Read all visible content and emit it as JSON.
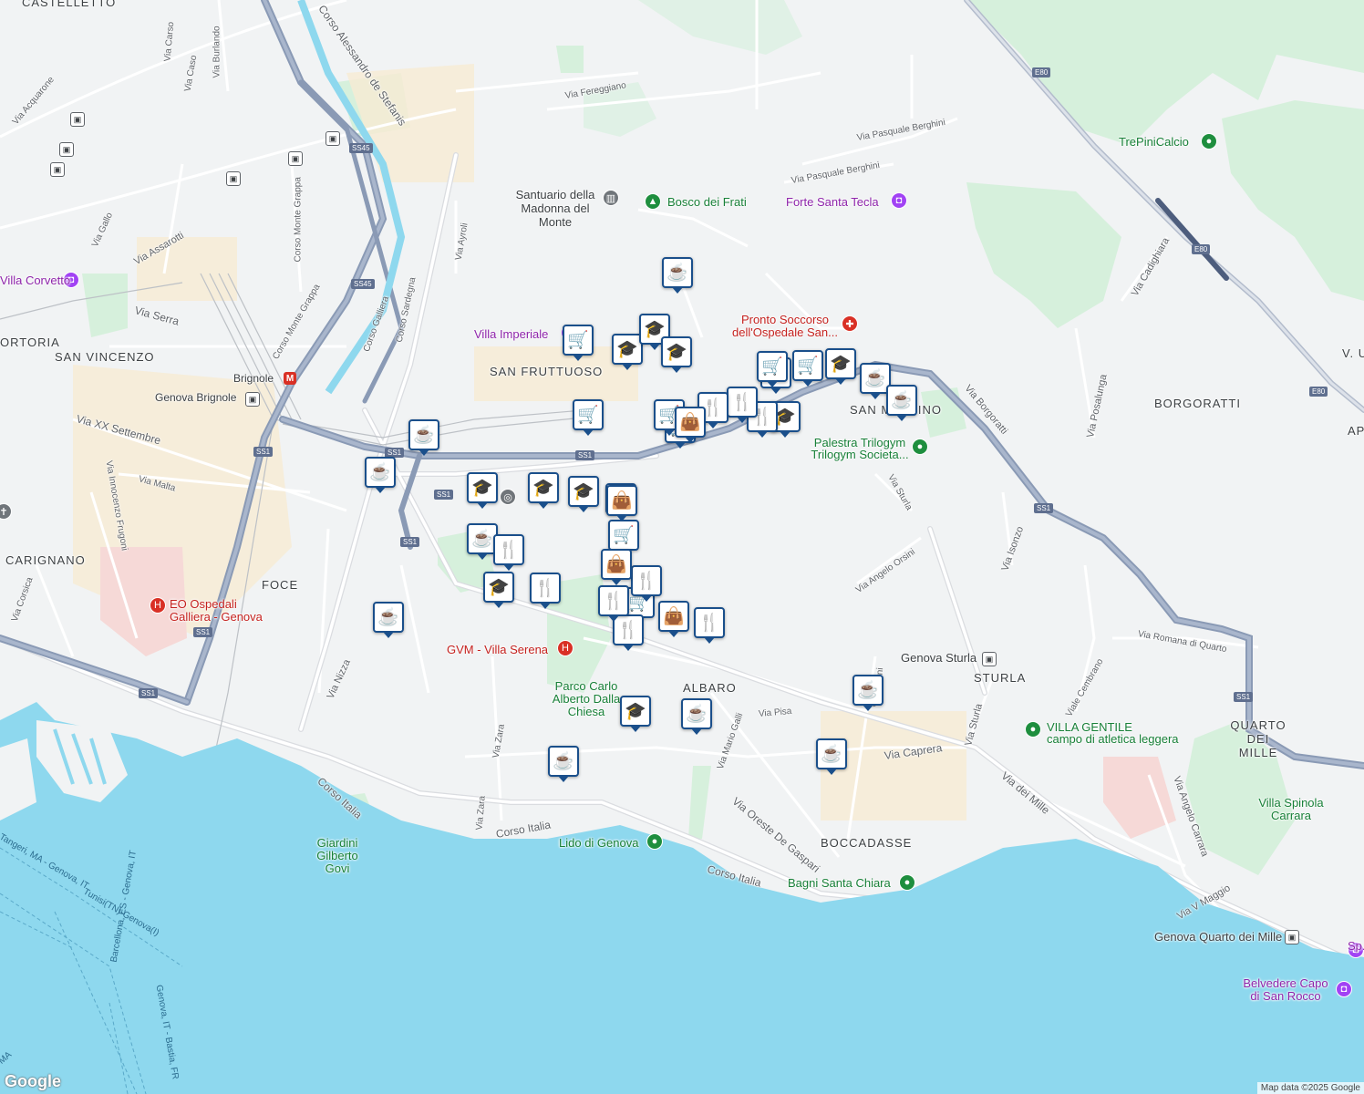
{
  "attribution": "Map data ©2025 Google",
  "logo": "Google",
  "colors": {
    "water": "#8ed8ee",
    "park": "#d6f0dc",
    "land": "#f1f3f4",
    "highway": "#8a9ab5",
    "marker_border": "#1a4f8b"
  },
  "districts": [
    "CASTELLETTO",
    "SAN VINCENZO",
    "ORTORIA",
    "SAN FRUTTUOSO",
    "CARIGNANO",
    "FOCE",
    "ALBARO",
    "SAN MARTINO",
    "BORGORATTI",
    "STURLA",
    "QUARTO DEI MILLE",
    "BOCCADASSE",
    "V. U",
    "AP"
  ],
  "streets": [
    "Via Pasquale Berghini",
    "Via Pasquale Berghini",
    "Via Fereggiano",
    "Via Acquarone",
    "Via Carso",
    "Via Caso",
    "Via Burlando",
    "Via Gallo",
    "Via Assarotti",
    "Corso Monte Grappa",
    "Corso Monte Grappa",
    "Via Serra",
    "Corso Galliera",
    "Corso Sardegna",
    "Via Ayroli",
    "Via XX Settembre",
    "Via Malta",
    "Via Innocenzo Frugoni",
    "Via Corsica",
    "Via Nizza",
    "Via Zara",
    "Via Zara",
    "Corso Italia",
    "Corso Italia",
    "Corso Italia",
    "Via Oreste De Gaspari",
    "Via Pisa",
    "Via Mario Galli",
    "Via Caprera",
    "Via dei Mille",
    "Via Sturla",
    "Via Sturla",
    "Via Angelo Orsini",
    "Via Isonzo",
    "Via Borgoratti",
    "Via Posalunga",
    "Via Cadighiara",
    "Viale Cembrano",
    "Via Romana di Quarto",
    "Via Angelo Carrara",
    "Via V Maggio",
    "Corso Alessandro de Stefanis",
    "Via Orsini",
    "Via Manuzio"
  ],
  "pois": [
    "Santuario della Madonna del Monte",
    "Bosco dei Frati",
    "Forte Santa Tecla",
    "Pronto Soccorso dell'Ospedale San...",
    "Villa Imperiale",
    "Palestra Trilogym Trilogym Societa...",
    "TrePiniCalcio",
    "Villa Corvetto",
    "Genova Brignole",
    "Brignole",
    "EO Ospedali Galliera - Genova",
    "GVM - Villa Serena",
    "Parco Carlo Alberto Dalla Chiesa",
    "Genova Sturla",
    "VILLA GENTILE",
    "campo di atletica leggera",
    "Lido di Genova",
    "Bagni Santa Chiara",
    "Giardini Gilberto Govi",
    "Villa Spinola Carrara",
    "Genova Quarto dei Mille",
    "Belvedere Capo di San Rocco",
    "Sp..."
  ],
  "road_shields": [
    "E80",
    "E80",
    "E80",
    "SS45",
    "SS45",
    "SS45",
    "SS1",
    "SS1",
    "SS1",
    "SS1",
    "SS1",
    "SS1",
    "SS1",
    "SS1"
  ],
  "sea_labels": [
    "Tunisi(TN)-Genova(I)",
    "Genova, IT - Bastia, FR",
    "Barcellona, ES - Genova, IT",
    "Tangeri, MA - Genova, IT",
    "Genova, IT",
    "MA"
  ],
  "markers": [
    {
      "type": "cafe",
      "icon": "coffee-cup"
    },
    {
      "type": "cafe",
      "icon": "coffee-cup"
    },
    {
      "type": "cafe",
      "icon": "coffee-cup"
    },
    {
      "type": "cafe",
      "icon": "coffee-cup"
    },
    {
      "type": "cafe",
      "icon": "coffee-cup"
    },
    {
      "type": "cafe",
      "icon": "coffee-cup"
    },
    {
      "type": "cafe",
      "icon": "coffee-cup"
    },
    {
      "type": "cafe",
      "icon": "coffee-cup"
    },
    {
      "type": "cafe",
      "icon": "coffee-cup"
    },
    {
      "type": "cafe",
      "icon": "coffee-cup"
    },
    {
      "type": "cafe",
      "icon": "coffee-cup"
    },
    {
      "type": "grocery",
      "icon": "shopping-cart"
    },
    {
      "type": "grocery",
      "icon": "shopping-cart"
    },
    {
      "type": "grocery",
      "icon": "shopping-cart"
    },
    {
      "type": "grocery",
      "icon": "shopping-cart"
    },
    {
      "type": "grocery",
      "icon": "shopping-cart"
    },
    {
      "type": "grocery",
      "icon": "shopping-cart"
    },
    {
      "type": "grocery",
      "icon": "shopping-cart"
    },
    {
      "type": "grocery",
      "icon": "shopping-cart"
    },
    {
      "type": "grocery",
      "icon": "shopping-cart"
    },
    {
      "type": "grocery",
      "icon": "shopping-cart"
    },
    {
      "type": "school",
      "icon": "graduation-cap"
    },
    {
      "type": "school",
      "icon": "graduation-cap"
    },
    {
      "type": "school",
      "icon": "graduation-cap"
    },
    {
      "type": "school",
      "icon": "graduation-cap"
    },
    {
      "type": "school",
      "icon": "graduation-cap"
    },
    {
      "type": "school",
      "icon": "graduation-cap"
    },
    {
      "type": "school",
      "icon": "graduation-cap"
    },
    {
      "type": "school",
      "icon": "graduation-cap"
    },
    {
      "type": "school",
      "icon": "graduation-cap"
    },
    {
      "type": "school",
      "icon": "graduation-cap"
    },
    {
      "type": "restaurant",
      "icon": "fork-knife"
    },
    {
      "type": "restaurant",
      "icon": "fork-knife"
    },
    {
      "type": "restaurant",
      "icon": "fork-knife"
    },
    {
      "type": "restaurant",
      "icon": "fork-knife"
    },
    {
      "type": "restaurant",
      "icon": "fork-knife"
    },
    {
      "type": "restaurant",
      "icon": "fork-knife"
    },
    {
      "type": "restaurant",
      "icon": "fork-knife"
    },
    {
      "type": "restaurant",
      "icon": "fork-knife"
    },
    {
      "type": "restaurant",
      "icon": "fork-knife"
    },
    {
      "type": "shopping",
      "icon": "shopping-bag"
    },
    {
      "type": "shopping",
      "icon": "shopping-bag"
    },
    {
      "type": "shopping",
      "icon": "shopping-bag"
    },
    {
      "type": "shopping",
      "icon": "shopping-bag"
    }
  ]
}
